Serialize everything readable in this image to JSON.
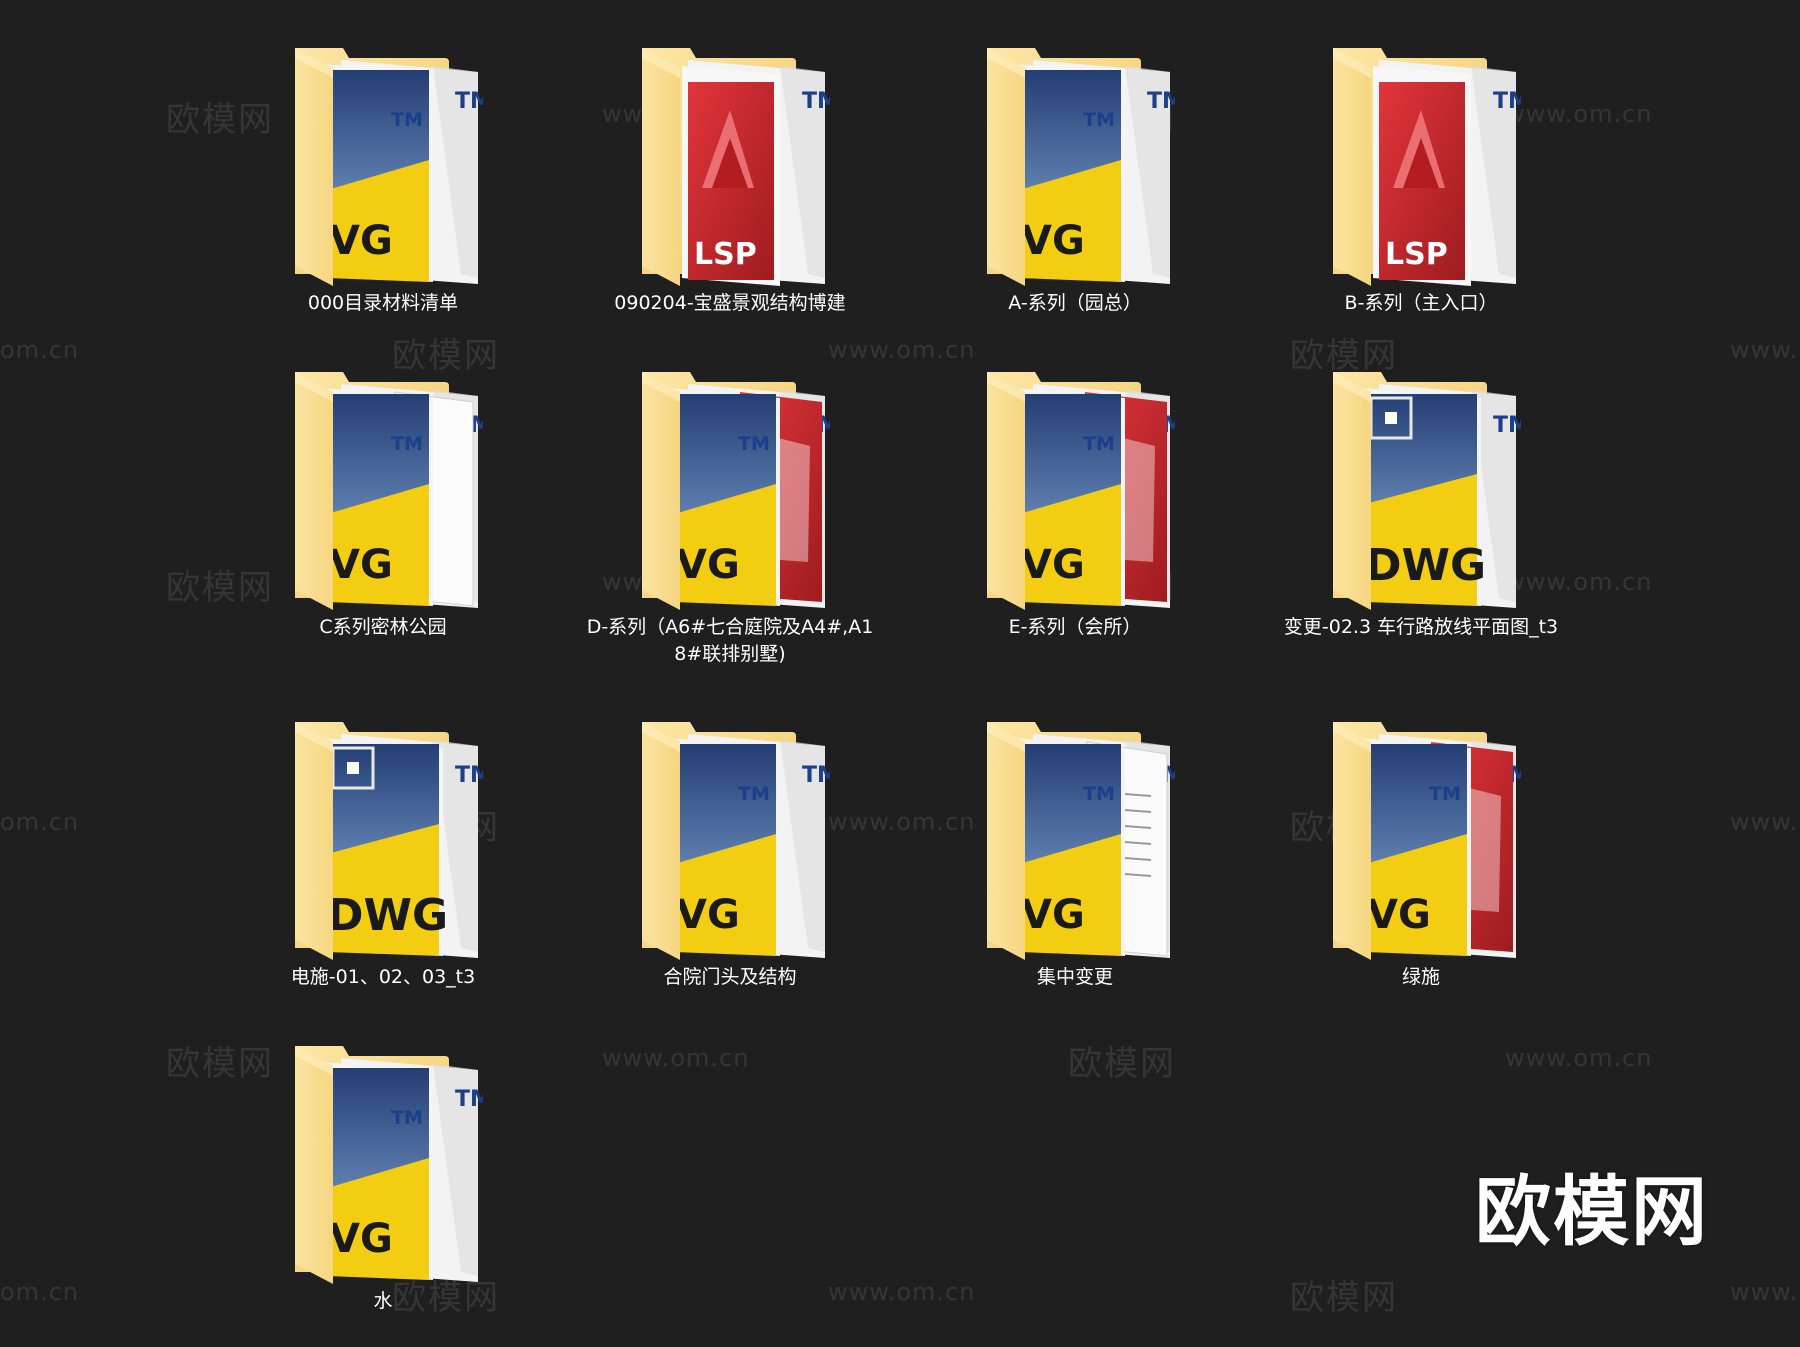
{
  "items": [
    {
      "label": "000目录材料清单",
      "icon": "dwg-folder-icon",
      "front": "dwg",
      "col": 0,
      "row": 0
    },
    {
      "label": "090204-宝盛景观结构博建",
      "icon": "lsp-folder-icon",
      "front": "lsp",
      "col": 1,
      "row": 0
    },
    {
      "label": "A-系列（园总）",
      "icon": "dwg-folder-icon",
      "front": "dwg",
      "col": 2,
      "row": 0
    },
    {
      "label": "B-系列（主入口）",
      "icon": "lsp-folder-icon",
      "front": "lsp",
      "col": 3,
      "row": 0
    },
    {
      "label": "C系列密林公园",
      "icon": "dwg-folder-icon",
      "front": "dwg-white",
      "col": 0,
      "row": 1
    },
    {
      "label": "D-系列（A6#七合庭院及A4#,A18#联排别墅)",
      "icon": "dwg-folder-icon",
      "front": "dwg-red",
      "col": 1,
      "row": 1
    },
    {
      "label": "E-系列（会所）",
      "icon": "dwg-folder-icon",
      "front": "dwg-red",
      "col": 2,
      "row": 1
    },
    {
      "label": "变更-02.3 车行路放线平面图_t3",
      "icon": "dwg-folder-icon",
      "front": "dwg-big",
      "col": 3,
      "row": 1
    },
    {
      "label": "电施-01、02、03_t3",
      "icon": "dwg-folder-icon",
      "front": "dwg-big",
      "col": 0,
      "row": 2
    },
    {
      "label": "合院门头及结构",
      "icon": "dwg-folder-icon",
      "front": "dwg",
      "col": 1,
      "row": 2
    },
    {
      "label": "集中变更",
      "icon": "dwg-folder-icon",
      "front": "dwg-doc",
      "col": 2,
      "row": 2
    },
    {
      "label": "绿施",
      "icon": "dwg-folder-icon",
      "front": "dwg-red",
      "col": 3,
      "row": 2
    },
    {
      "label": "水",
      "icon": "dwg-folder-icon",
      "front": "dwg",
      "col": 0,
      "row": 3
    }
  ],
  "watermark": {
    "text_cn": "欧模网",
    "text_url": "www.om.cn",
    "text_url_short": "om.cn",
    "text_url_prefix": "www."
  },
  "brand_mark": "欧模网",
  "colors": {
    "background": "#1f1f1f",
    "folder": "#f5d47a",
    "dwg_blue": "#2f4f86",
    "dwg_yellow": "#f2cd11",
    "lsp_red": "#c3262b"
  }
}
